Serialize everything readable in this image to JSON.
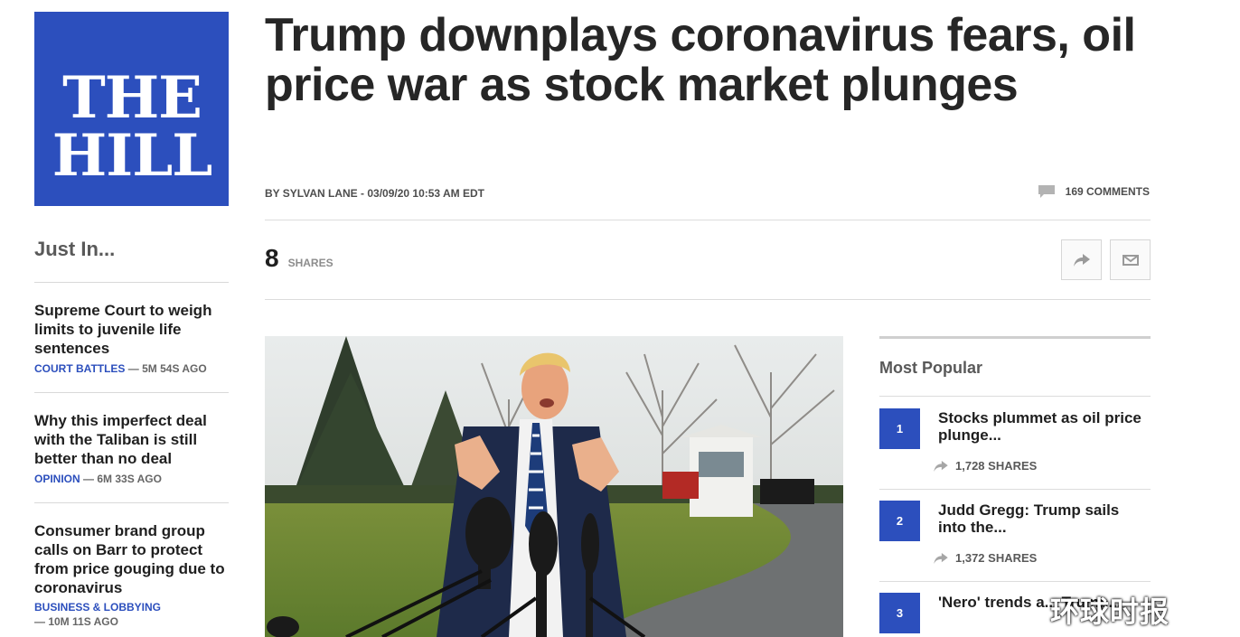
{
  "brand": {
    "logo_line1": "THE",
    "logo_line2": "HILL",
    "color": "#2c4fbd"
  },
  "article": {
    "headline": "Trump downplays coronavirus fears, oil price war as stock market plunges",
    "byline": "BY SYLVAN LANE - 03/09/20 10:53 AM EDT",
    "comments": "169 COMMENTS",
    "shares_count": "8",
    "shares_label": "SHARES"
  },
  "just_in": {
    "title": "Just In...",
    "items": [
      {
        "title": "Supreme Court to weigh limits to juvenile life sentences",
        "category": "COURT BATTLES",
        "time": " — 5M 54S AGO"
      },
      {
        "title": "Why this imperfect deal with the Taliban is still better than no deal",
        "category": "OPINION",
        "time": " — 6M 33S AGO"
      },
      {
        "title": "Consumer brand group calls on Barr to protect from price gouging due to coronavirus",
        "category": "BUSINESS & LOBBYING",
        "time": "— 10M 11S AGO"
      }
    ]
  },
  "most_popular": {
    "title": "Most Popular",
    "items": [
      {
        "rank": "1",
        "title": "Stocks plummet as oil price plunge...",
        "shares": "1,728 SHARES"
      },
      {
        "rank": "2",
        "title": "Judd Gregg: Trump sails into the...",
        "shares": "1,372 SHARES"
      },
      {
        "rank": "3",
        "title": "'Nero' trends a... Trump...",
        "shares": ""
      }
    ]
  },
  "watermark": "环球时报"
}
